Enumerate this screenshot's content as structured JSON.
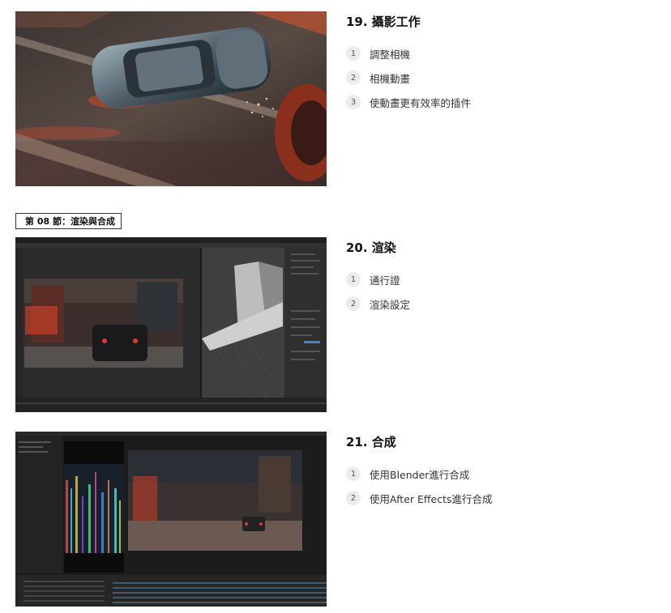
{
  "chapter_tag": "第 08 節：渲染與合成",
  "lessons": [
    {
      "title": "19. 攝影工作",
      "items": [
        {
          "num": "1",
          "label": "調整相機"
        },
        {
          "num": "2",
          "label": "相機動畫"
        },
        {
          "num": "3",
          "label": "使動畫更有效率的插件"
        }
      ]
    },
    {
      "title": "20. 渲染",
      "items": [
        {
          "num": "1",
          "label": "通行證"
        },
        {
          "num": "2",
          "label": "渲染設定"
        }
      ]
    },
    {
      "title": "21. 合成",
      "items": [
        {
          "num": "1",
          "label": "使用Blender進行合成"
        },
        {
          "num": "2",
          "label": "使用After Effects進行合成"
        }
      ]
    }
  ]
}
